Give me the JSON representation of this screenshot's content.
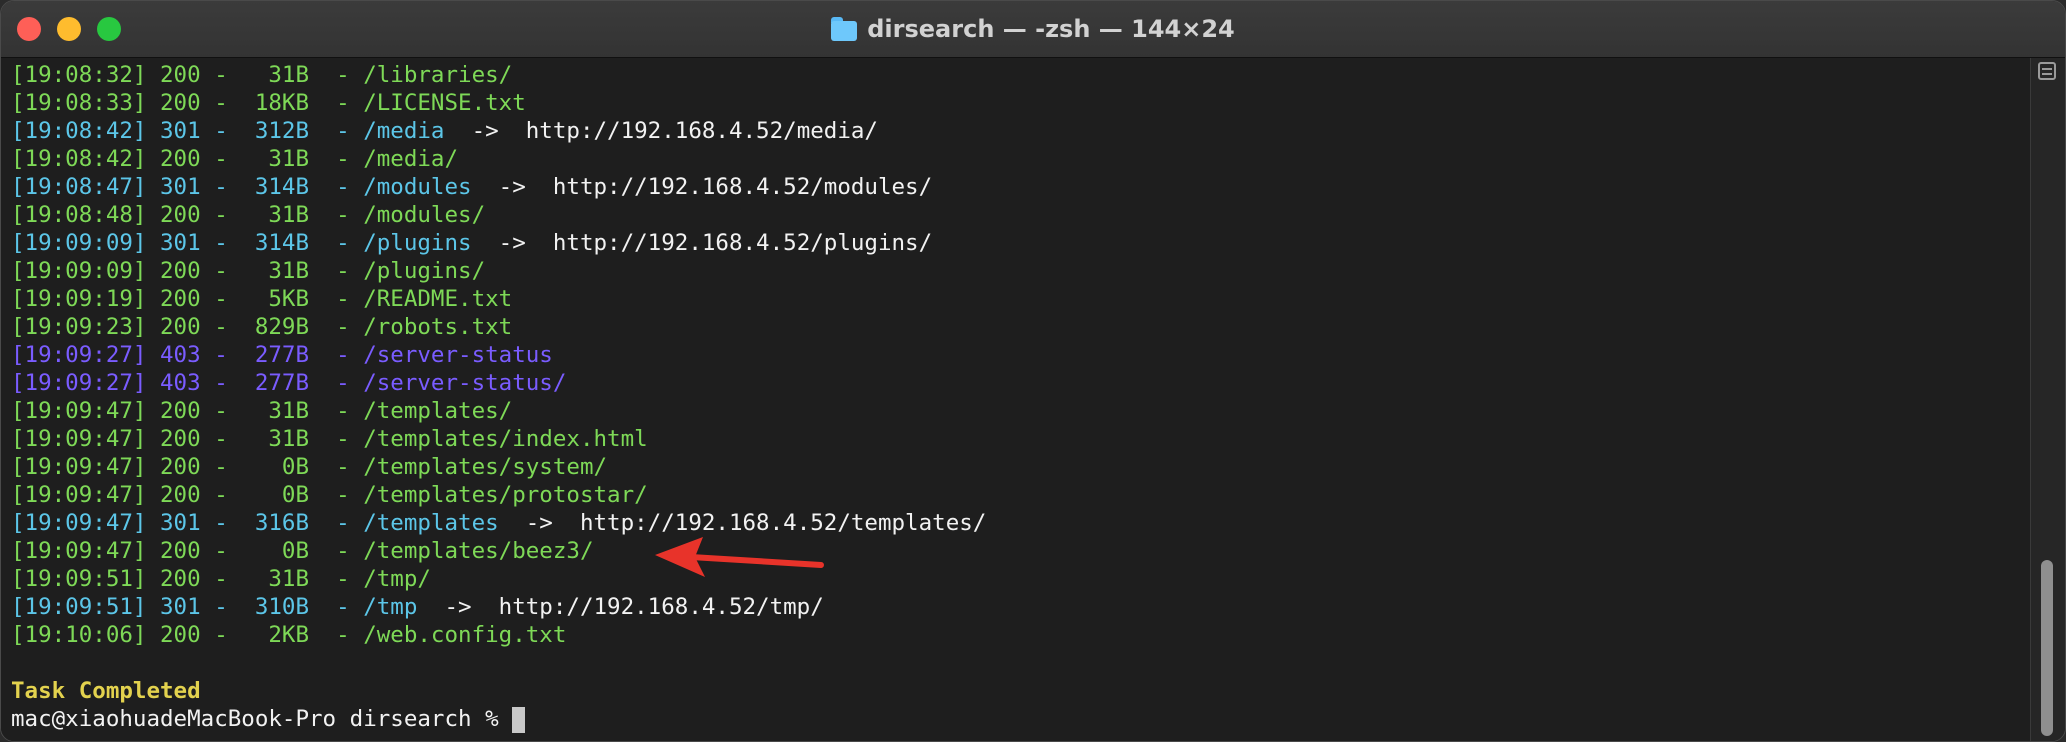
{
  "window": {
    "title": "dirsearch — -zsh — 144×24",
    "icon": "folder-icon"
  },
  "colors": {
    "status_200": "#7ed957",
    "status_301": "#5cc6e8",
    "status_403": "#7a5cff",
    "redirect_target": "#f2f2f2",
    "task_completed": "#e3d24e",
    "annotation_arrow": "#e8332a"
  },
  "log": [
    {
      "time": "[19:08:32]",
      "code": "200",
      "size": "31B",
      "path": "/libraries/"
    },
    {
      "time": "[19:08:33]",
      "code": "200",
      "size": "18KB",
      "path": "/LICENSE.txt"
    },
    {
      "time": "[19:08:42]",
      "code": "301",
      "size": "312B",
      "path": "/media",
      "target": "http://192.168.4.52/media/"
    },
    {
      "time": "[19:08:42]",
      "code": "200",
      "size": "31B",
      "path": "/media/"
    },
    {
      "time": "[19:08:47]",
      "code": "301",
      "size": "314B",
      "path": "/modules",
      "target": "http://192.168.4.52/modules/"
    },
    {
      "time": "[19:08:48]",
      "code": "200",
      "size": "31B",
      "path": "/modules/"
    },
    {
      "time": "[19:09:09]",
      "code": "301",
      "size": "314B",
      "path": "/plugins",
      "target": "http://192.168.4.52/plugins/"
    },
    {
      "time": "[19:09:09]",
      "code": "200",
      "size": "31B",
      "path": "/plugins/"
    },
    {
      "time": "[19:09:19]",
      "code": "200",
      "size": "5KB",
      "path": "/README.txt"
    },
    {
      "time": "[19:09:23]",
      "code": "200",
      "size": "829B",
      "path": "/robots.txt"
    },
    {
      "time": "[19:09:27]",
      "code": "403",
      "size": "277B",
      "path": "/server-status"
    },
    {
      "time": "[19:09:27]",
      "code": "403",
      "size": "277B",
      "path": "/server-status/"
    },
    {
      "time": "[19:09:47]",
      "code": "200",
      "size": "31B",
      "path": "/templates/"
    },
    {
      "time": "[19:09:47]",
      "code": "200",
      "size": "31B",
      "path": "/templates/index.html"
    },
    {
      "time": "[19:09:47]",
      "code": "200",
      "size": "0B",
      "path": "/templates/system/"
    },
    {
      "time": "[19:09:47]",
      "code": "200",
      "size": "0B",
      "path": "/templates/protostar/"
    },
    {
      "time": "[19:09:47]",
      "code": "301",
      "size": "316B",
      "path": "/templates",
      "target": "http://192.168.4.52/templates/"
    },
    {
      "time": "[19:09:47]",
      "code": "200",
      "size": "0B",
      "path": "/templates/beez3/"
    },
    {
      "time": "[19:09:51]",
      "code": "200",
      "size": "31B",
      "path": "/tmp/"
    },
    {
      "time": "[19:09:51]",
      "code": "301",
      "size": "310B",
      "path": "/tmp",
      "target": "http://192.168.4.52/tmp/"
    },
    {
      "time": "[19:10:06]",
      "code": "200",
      "size": "2KB",
      "path": "/web.config.txt"
    }
  ],
  "status": {
    "completed": "Task Completed"
  },
  "prompt": {
    "text": "mac@xiaohuadeMacBook-Pro dirsearch % "
  },
  "annotation": {
    "highlighted_path": "/templates/beez3/"
  }
}
